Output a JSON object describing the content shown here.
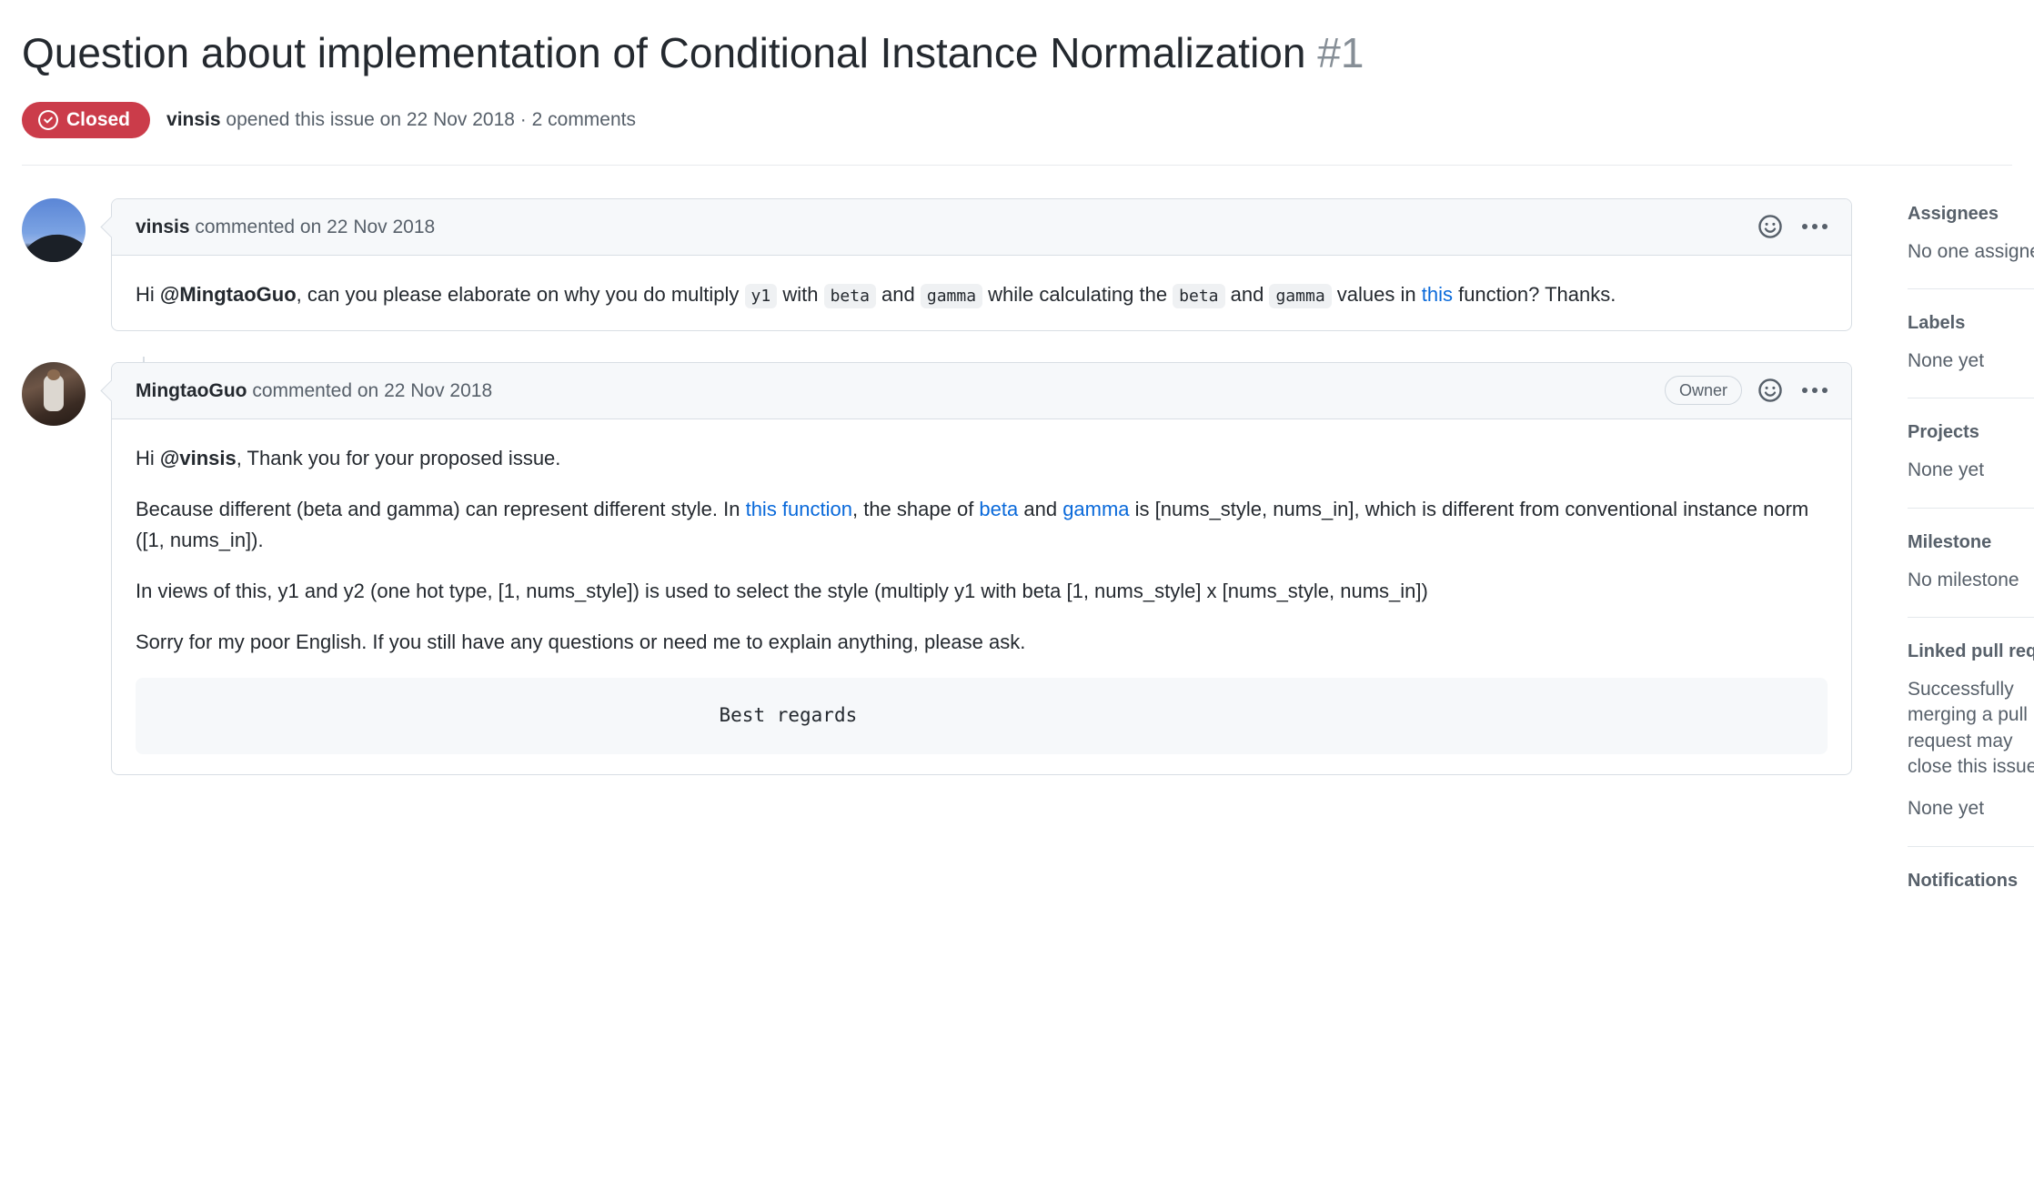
{
  "issue": {
    "title": "Question about implementation of Conditional Instance Normalization",
    "number": "#1",
    "state_label": "Closed",
    "state_color": "#cb3c4a",
    "meta_author": "vinsis",
    "meta_rest": " opened this issue on 22 Nov 2018 · 2 comments"
  },
  "comments": [
    {
      "author": "vinsis",
      "commented_on": " commented on 22 Nov 2018",
      "badge": null,
      "body": {
        "p1_a": "Hi ",
        "p1_mention": "@MingtaoGuo",
        "p1_b": ", can you please elaborate on why you do multiply ",
        "p1_code1": "y1",
        "p1_c": " with ",
        "p1_code2": "beta",
        "p1_d": " and ",
        "p1_code3": "gamma",
        "p1_e": " while calculating the ",
        "p1_code4": "beta",
        "p1_f": " and ",
        "p1_code5": "gamma",
        "p1_g": " values in ",
        "p1_link": "this",
        "p1_h": " function? Thanks."
      }
    },
    {
      "author": "MingtaoGuo",
      "commented_on": " commented on 22 Nov 2018",
      "badge": "Owner",
      "body": {
        "p1_a": "Hi ",
        "p1_mention": "@vinsis",
        "p1_b": ", Thank you for your proposed issue.",
        "p2_a": "Because different (beta and gamma) can represent different style. In ",
        "p2_link1": "this function",
        "p2_b": ", the shape of ",
        "p2_link2": "beta",
        "p2_c": " and ",
        "p2_link3": "gamma",
        "p2_d": " is [nums_style, nums_in], which is different from conventional instance norm ([1, nums_in]).",
        "p3": "In views of this, y1 and y2 (one hot type, [1, nums_style]) is used to select the style (multiply y1 with beta [1, nums_style] x [nums_style, nums_in])",
        "p4": "Sorry for my poor English. If you still have any questions or need me to explain anything, please ask.",
        "code_block": "                                                 Best regards"
      }
    }
  ],
  "sidebar": {
    "sections": [
      {
        "title": "Assignees",
        "values": [
          "No one assigned"
        ]
      },
      {
        "title": "Labels",
        "values": [
          "None yet"
        ]
      },
      {
        "title": "Projects",
        "values": [
          "None yet"
        ]
      },
      {
        "title": "Milestone",
        "values": [
          "No milestone"
        ]
      },
      {
        "title": "Linked pull requests",
        "values": [
          "Successfully merging a pull request may close this issue.",
          "None yet"
        ]
      },
      {
        "title": "Notifications",
        "values": []
      }
    ]
  },
  "icons": {
    "reaction": "smiley-icon",
    "menu": "kebab-menu-icon",
    "state": "issue-closed-icon"
  }
}
